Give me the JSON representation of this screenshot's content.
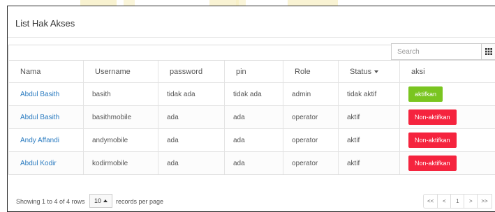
{
  "panel": {
    "title": "List Hak Akses"
  },
  "toolbar": {
    "search_placeholder": "Search",
    "columns_icon": "grid-icon"
  },
  "table": {
    "columns": [
      "Nama",
      "Username",
      "password",
      "pin",
      "Role",
      "Status",
      "aksi"
    ],
    "rows": [
      {
        "nama": "Abdul Basith",
        "username": "basith",
        "password": "tidak ada",
        "pin": "tidak ada",
        "role": "admin",
        "status": "tidak aktif",
        "action": "aktifkan",
        "action_type": "activate"
      },
      {
        "nama": "Abdul Basith",
        "username": "basithmobile",
        "password": "ada",
        "pin": "ada",
        "role": "operator",
        "status": "aktif",
        "action": "Non-aktifkan",
        "action_type": "deactivate"
      },
      {
        "nama": "Andy Affandi",
        "username": "andymobile",
        "password": "ada",
        "pin": "ada",
        "role": "operator",
        "status": "aktif",
        "action": "Non-aktifkan",
        "action_type": "deactivate"
      },
      {
        "nama": "Abdul Kodir",
        "username": "kodirmobile",
        "password": "ada",
        "pin": "ada",
        "role": "operator",
        "status": "aktif",
        "action": "Non-aktifkan",
        "action_type": "deactivate"
      }
    ]
  },
  "footer": {
    "showing": "Showing 1 to 4 of 4 rows",
    "per_page_value": "10",
    "per_page_suffix": "records per page"
  },
  "pagination": {
    "first": "<<",
    "prev": "<",
    "current": "1",
    "next": ">",
    "last": ">>"
  },
  "colors": {
    "link": "#2a7bc0",
    "activate": "#7ac520",
    "deactivate": "#f5243e",
    "watermark_gold": "#f2e6a6"
  }
}
